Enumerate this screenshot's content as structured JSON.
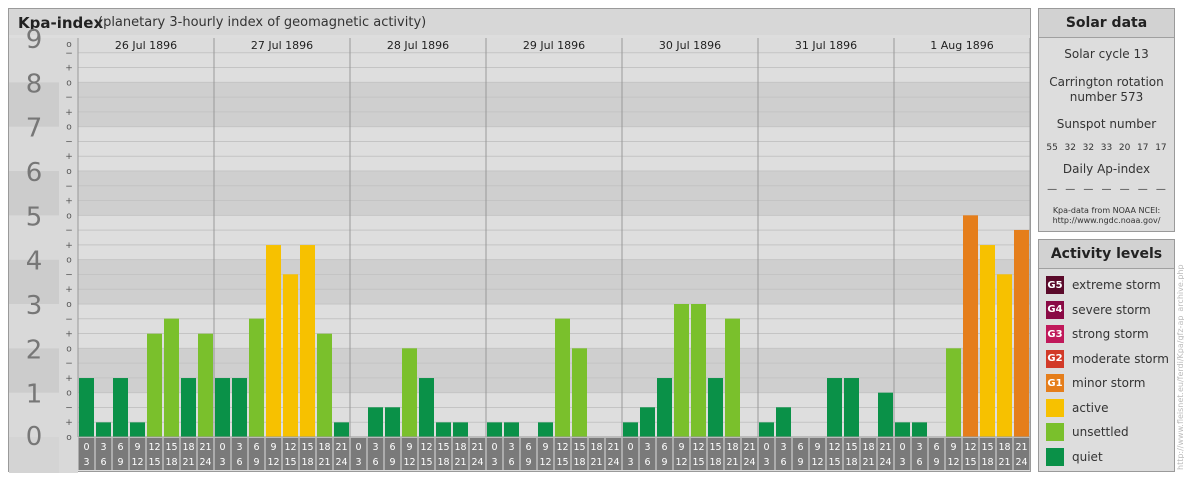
{
  "header": {
    "title": "Kpa-index",
    "subtitle": "(planetary 3-hourly index of geomagnetic activity)"
  },
  "chart_data": {
    "type": "bar",
    "y_levels": [
      "0",
      "1",
      "2",
      "3",
      "4",
      "5",
      "6",
      "7",
      "8",
      "9"
    ],
    "y_minor_marks": [
      "o",
      "+",
      "−"
    ],
    "ylim": [
      0,
      9
    ],
    "days": [
      "26 Jul 1896",
      "27 Jul 1896",
      "28 Jul 1896",
      "29 Jul 1896",
      "30 Jul 1896",
      "31 Jul 1896",
      "1 Aug 1896"
    ],
    "intervals": [
      [
        "0",
        "3"
      ],
      [
        "3",
        "6"
      ],
      [
        "6",
        "9"
      ],
      [
        "9",
        "12"
      ],
      [
        "12",
        "15"
      ],
      [
        "15",
        "18"
      ],
      [
        "18",
        "21"
      ],
      [
        "21",
        "24"
      ]
    ],
    "values": [
      [
        1.33,
        0.33,
        1.33,
        0.33,
        2.33,
        2.67,
        1.33,
        2.33
      ],
      [
        1.33,
        1.33,
        2.67,
        4.33,
        3.67,
        4.33,
        2.33,
        0.33
      ],
      [
        0,
        0.67,
        0.67,
        2,
        1.33,
        0.33,
        0.33,
        0
      ],
      [
        0.33,
        0.33,
        0,
        0.33,
        2.67,
        2,
        0,
        0
      ],
      [
        0.33,
        0.67,
        1.33,
        3,
        3,
        1.33,
        2.67,
        0
      ],
      [
        0.33,
        0.67,
        0,
        0,
        1.33,
        1.33,
        0,
        1
      ],
      [
        0.33,
        0.33,
        0,
        2,
        5,
        4.33,
        3.67,
        4.67
      ]
    ],
    "level_colors": {
      "quiet": "#0a9148",
      "unsettled": "#7ac02c",
      "active": "#f7c100",
      "minor": "#e57e1b"
    }
  },
  "solar": {
    "heading": "Solar data",
    "cycle": "Solar cycle 13",
    "carrington_line1": "Carrington rotation",
    "carrington_line2": "number 573",
    "sunspot_heading": "Sunspot number",
    "sunspots": [
      "55",
      "32",
      "32",
      "33",
      "20",
      "17",
      "17"
    ],
    "ap_heading": "Daily Ap-index",
    "ap_values": [
      "—",
      "—",
      "—",
      "—",
      "—",
      "—",
      "—"
    ],
    "source_line1": "Kpa-data from NOAA NCEI:",
    "source_line2": "http://www.ngdc.noaa.gov/"
  },
  "activity": {
    "heading": "Activity levels",
    "levels": [
      {
        "code": "G5",
        "label": "extreme storm",
        "color": "#5a0a2a"
      },
      {
        "code": "G4",
        "label": "severe storm",
        "color": "#8a0a45"
      },
      {
        "code": "G3",
        "label": "strong storm",
        "color": "#c0185a"
      },
      {
        "code": "G2",
        "label": "moderate storm",
        "color": "#d23a28"
      },
      {
        "code": "G1",
        "label": "minor storm",
        "color": "#e57e1b"
      },
      {
        "code": "",
        "label": "active",
        "color": "#f7c100"
      },
      {
        "code": "",
        "label": "unsettled",
        "color": "#7ac02c"
      },
      {
        "code": "",
        "label": "quiet",
        "color": "#0a9148"
      }
    ]
  },
  "credit": "http://www.fleisnet.eu/ferdi/Kpa/gfz-ap_archive.php"
}
